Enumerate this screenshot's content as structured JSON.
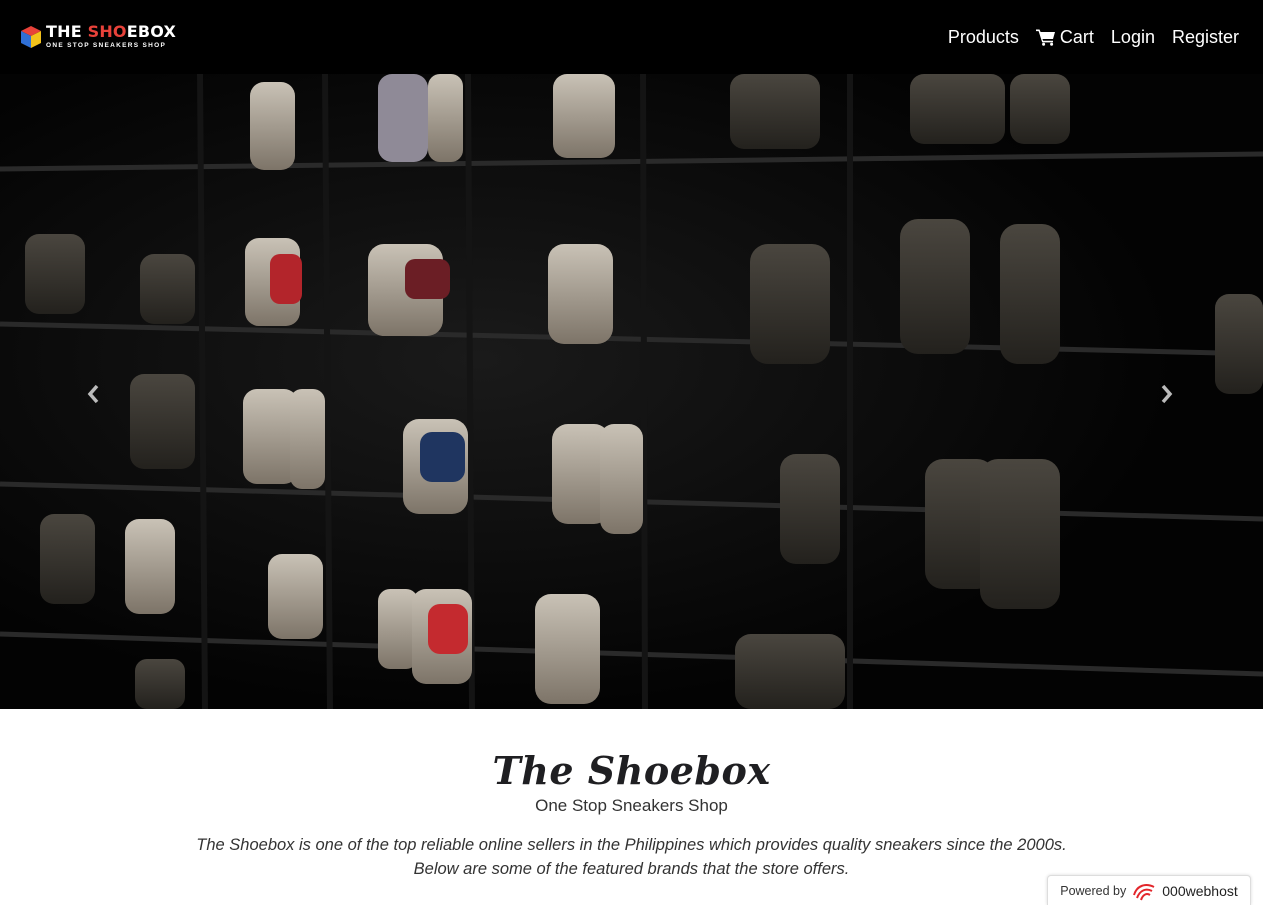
{
  "brand": {
    "name_prefix": "THE ",
    "name_accent": "SHO",
    "name_suffix": "EBOX",
    "tagline": "ONE STOP SNEAKERS SHOP"
  },
  "nav": {
    "products": "Products",
    "cart": "Cart",
    "login": "Login",
    "register": "Register"
  },
  "hero": {
    "image_icon": "bowling-shoe-rack-photo",
    "prev_icon": "chevron-left-icon",
    "next_icon": "chevron-right-icon"
  },
  "intro": {
    "title": "The Shoebox",
    "subtitle": "One Stop Sneakers Shop",
    "description_line1": "The Shoebox is one of the top reliable online sellers in the Philippines which provides quality sneakers since the 2000s.",
    "description_line2": "Below are some of the featured brands that the store offers."
  },
  "footer_badge": {
    "powered_by": "Powered by",
    "host": "000webhost"
  },
  "colors": {
    "nav_bg": "#000000",
    "accent": "#e8423a",
    "hero_bg": "#060606",
    "text": "#222222"
  }
}
